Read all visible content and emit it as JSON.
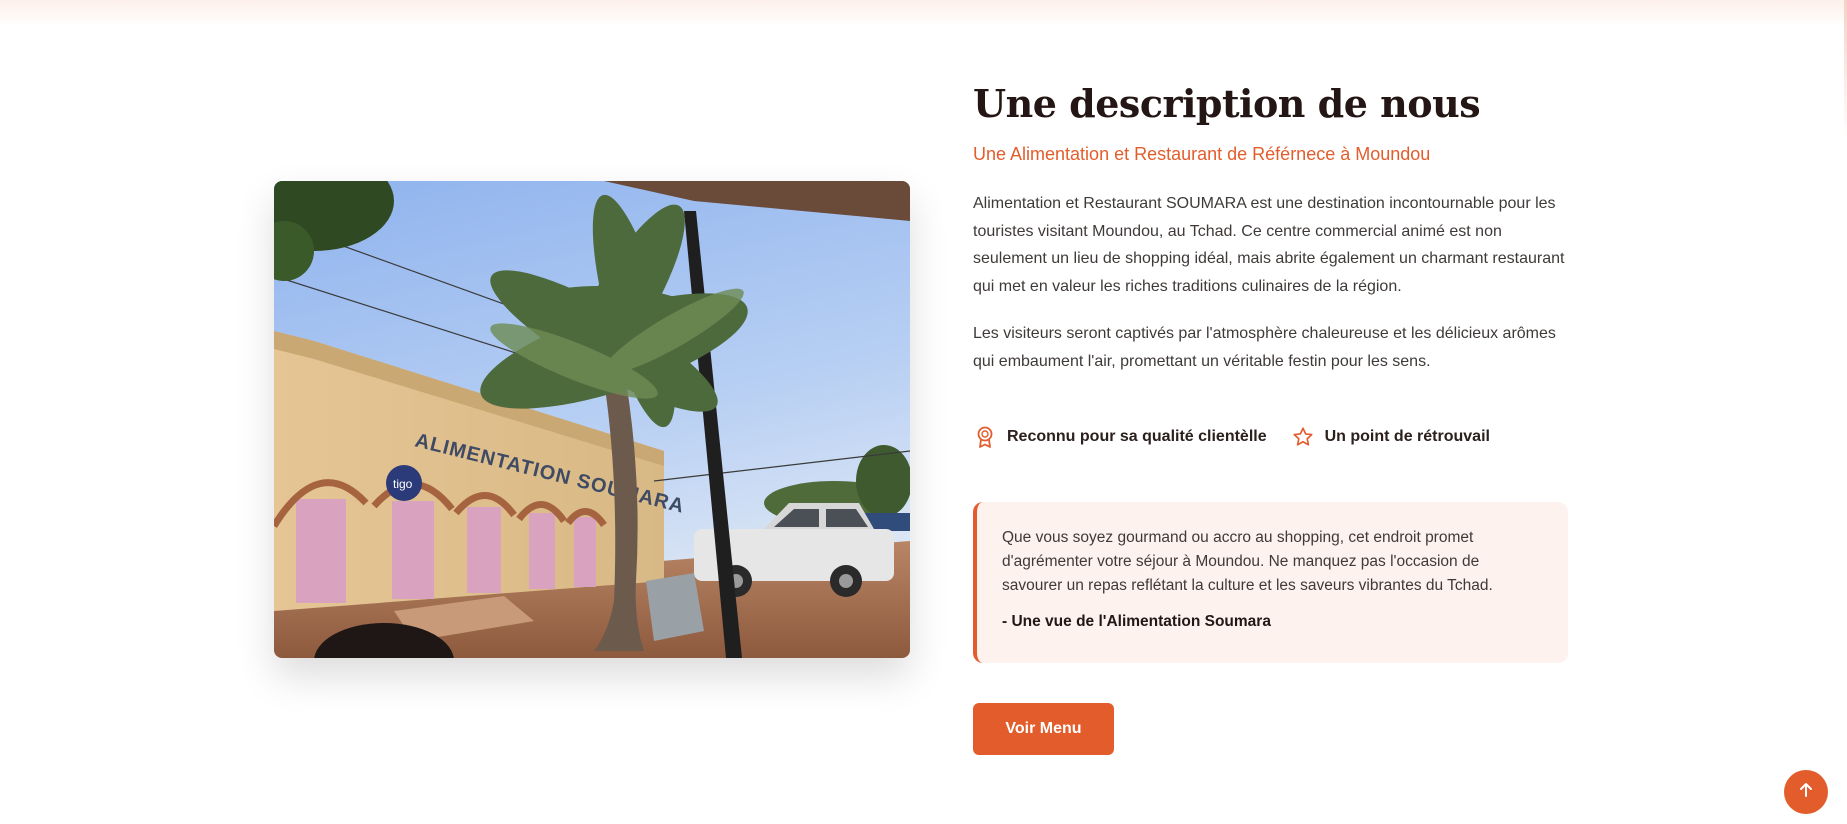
{
  "about": {
    "title": "Une description de nous",
    "subtitle": "Une Alimentation et Restaurant de Référnece à Moundou",
    "paragraph1": "Alimentation et Restaurant SOUMARA est une destination incontournable pour les touristes visitant Moundou, au Tchad. Ce centre commercial animé est non seulement un lieu de shopping idéal, mais abrite également un charmant restaurant qui met en valeur les riches traditions culinaires de la région.",
    "paragraph2": "Les visiteurs seront captivés par l'atmosphère chaleureuse et les délicieux arômes qui embaument l'air, promettant un véritable festin pour les sens.",
    "features": [
      {
        "icon": "award-icon",
        "label": "Reconnu pour sa qualité clientèlle"
      },
      {
        "icon": "star-icon",
        "label": "Un point de rétrouvail"
      }
    ],
    "quote": {
      "text": "Que vous soyez gourmand ou accro au shopping, cet endroit promet d'agrémenter votre séjour à Moundou. Ne manquez pas l'occasion de savourer un repas reflétant la culture et les saveurs vibrantes du Tchad.",
      "author": "- Une vue de l'Alimentation Soumara"
    },
    "button_label": "Voir Menu",
    "photo": {
      "sign_text": "ALIMENTATION SOUMARA",
      "badge_text": "tigo"
    }
  },
  "back_to_top_icon": "arrow-up-icon",
  "colors": {
    "accent": "#e35d2c",
    "quote_bg": "#fdf2ee",
    "heading": "#231614"
  }
}
